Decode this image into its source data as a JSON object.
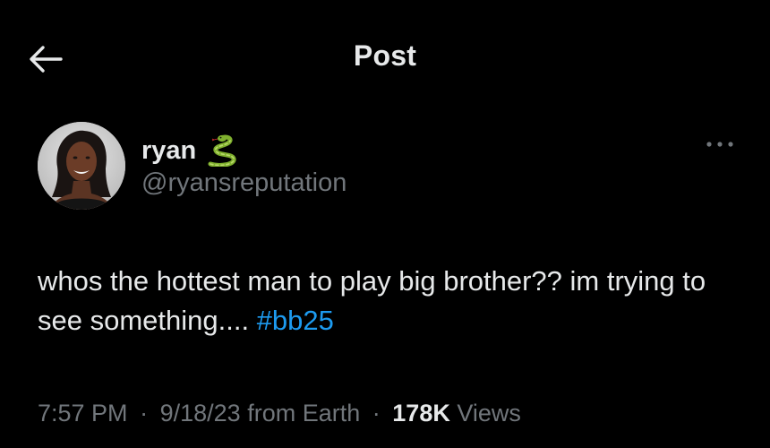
{
  "header": {
    "title": "Post",
    "back_icon": "arrow-left-icon"
  },
  "author": {
    "display_name": "ryan",
    "emoji": "snake-emoji",
    "handle": "@ryansreputation",
    "more_icon": "ellipsis-icon"
  },
  "tweet": {
    "text_part1": "whos the hottest man to play big brother?? im trying to see something.... ",
    "hashtag": "#bb25"
  },
  "meta": {
    "time": "7:57 PM",
    "separator": "·",
    "date": "9/18/23",
    "location": "from Earth",
    "views_count": "178K",
    "views_label": "Views"
  },
  "colors": {
    "background": "#000000",
    "text_primary": "#e7e9ea",
    "text_secondary": "#71767b",
    "link": "#1d9bf0"
  }
}
